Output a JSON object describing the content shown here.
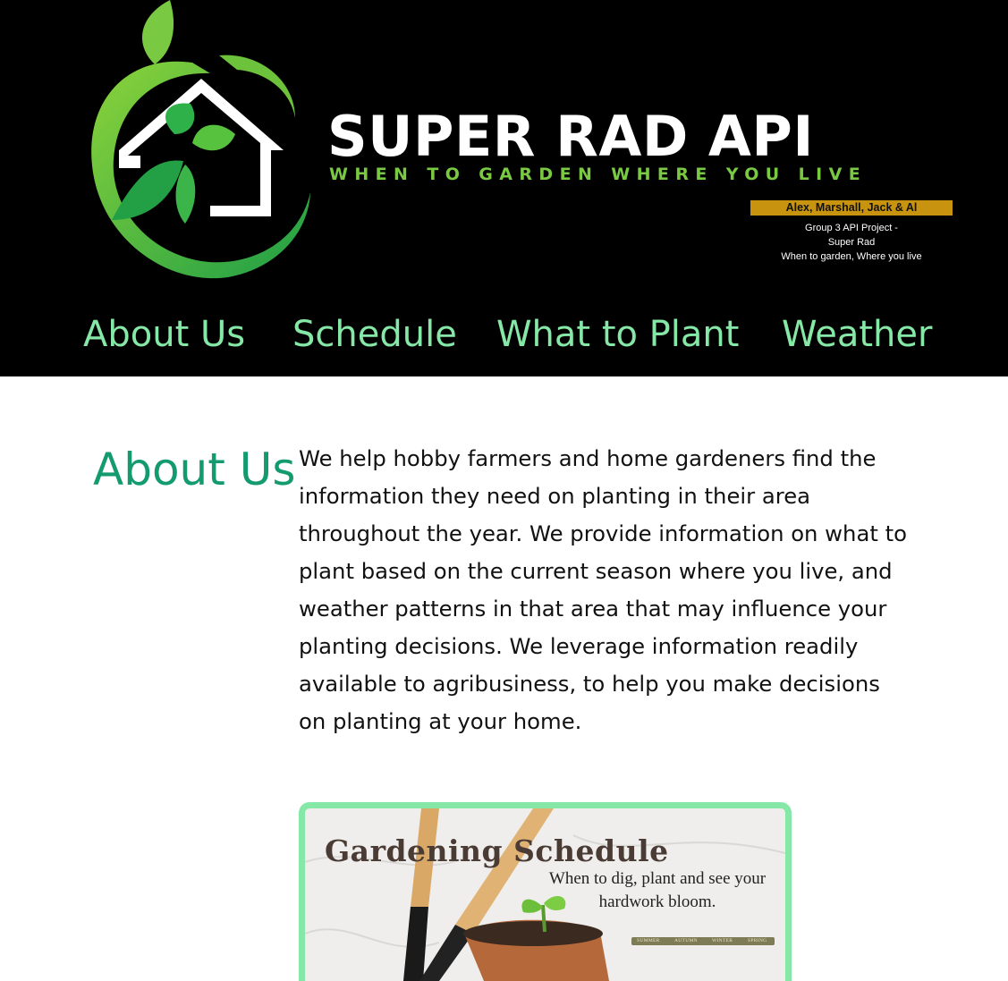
{
  "header": {
    "logo_icon": "house-sprout-logo-icon",
    "brand_title": "SUPER RAD API",
    "brand_tagline": "WHEN TO GARDEN WHERE YOU LIVE",
    "team": "Alex, Marshall, Jack & Al",
    "project_lines": [
      "Group 3 API Project -",
      "Super Rad",
      "When to garden, Where you live"
    ]
  },
  "nav": {
    "items": [
      {
        "label": "About Us"
      },
      {
        "label": "Schedule"
      },
      {
        "label": "What to Plant"
      },
      {
        "label": "Weather"
      }
    ]
  },
  "about": {
    "heading": "About Us",
    "body": "We help hobby farmers and home gardeners find the information they need on planting in their area throughout the year. We provide information on what to plant based on the current season where you live, and weather patterns in that area that may influence your planting decisions. We leverage information readily available to agribusiness, to help you make decisions on planting at your home."
  },
  "schedule_card": {
    "title": "Gardening Schedule",
    "subtitle": "When to dig, plant and see your hardwork bloom.",
    "seasons": [
      "SUMMER",
      "AUTUMN",
      "WINTER",
      "SPRING"
    ]
  },
  "colors": {
    "header_bg": "#000000",
    "nav_text": "#86e8a6",
    "heading": "#139a6f",
    "logo_green": "#7ac943",
    "badge": "#c8930e",
    "card_border": "#86e8a6"
  }
}
